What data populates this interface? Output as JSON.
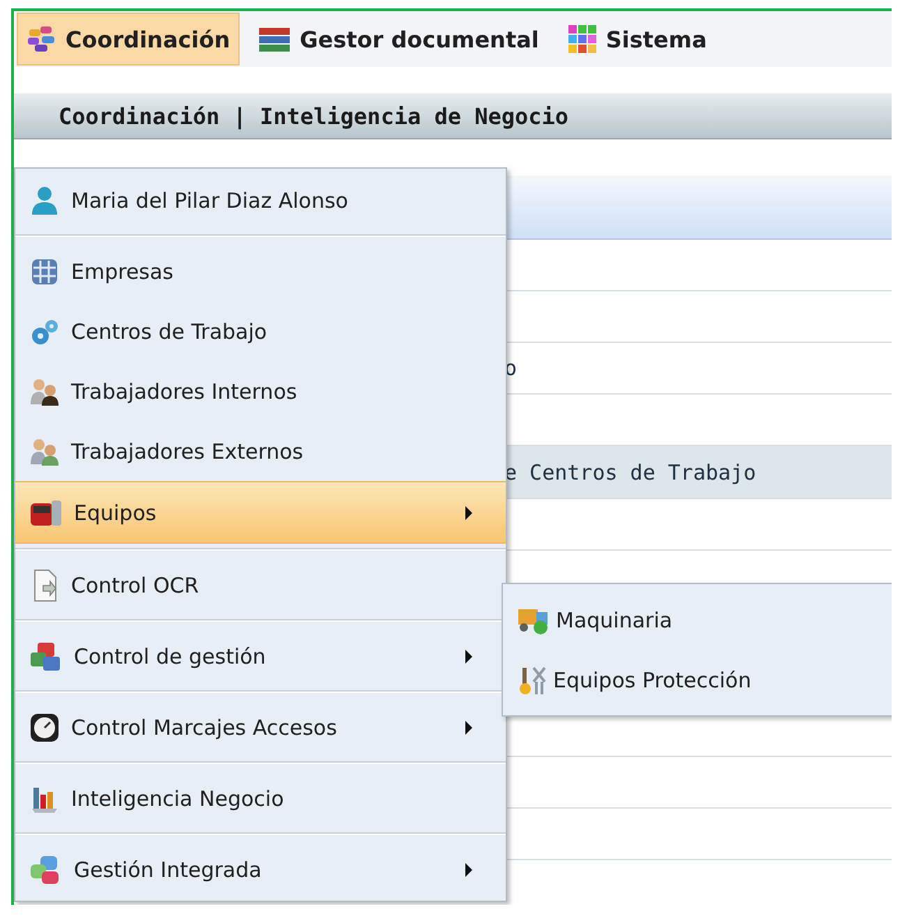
{
  "menubar": [
    {
      "label": "Coordinación",
      "selected": true
    },
    {
      "label": "Gestor documental",
      "selected": false
    },
    {
      "label": "Sistema",
      "selected": false
    }
  ],
  "breadcrumb": "Coordinación | Inteligencia de Negocio",
  "background_rows": [
    {
      "kind": "blank"
    },
    {
      "kind": "header"
    },
    {
      "kind": "row"
    },
    {
      "kind": "row"
    },
    {
      "kind": "row",
      "text": "o"
    },
    {
      "kind": "row"
    },
    {
      "kind": "section",
      "text": "e Centros de Trabajo"
    },
    {
      "kind": "row"
    },
    {
      "kind": "row"
    },
    {
      "kind": "row"
    },
    {
      "kind": "row"
    },
    {
      "kind": "row"
    },
    {
      "kind": "row"
    },
    {
      "kind": "row"
    }
  ],
  "menu": [
    {
      "label": "Maria del Pilar Diaz Alonso",
      "submenu": false,
      "selected": false,
      "divider_after": true
    },
    {
      "label": "Empresas",
      "submenu": false,
      "selected": false,
      "divider_after": false
    },
    {
      "label": "Centros de Trabajo",
      "submenu": false,
      "selected": false,
      "divider_after": false
    },
    {
      "label": "Trabajadores Internos",
      "submenu": false,
      "selected": false,
      "divider_after": false
    },
    {
      "label": "Trabajadores Externos",
      "submenu": false,
      "selected": false,
      "divider_after": false
    },
    {
      "label": "Equipos",
      "submenu": true,
      "selected": true,
      "divider_after": true
    },
    {
      "label": "Control OCR",
      "submenu": false,
      "selected": false,
      "divider_after": true
    },
    {
      "label": "Control de gestión",
      "submenu": true,
      "selected": false,
      "divider_after": true
    },
    {
      "label": "Control Marcajes Accesos",
      "submenu": true,
      "selected": false,
      "divider_after": true
    },
    {
      "label": "Inteligencia Negocio",
      "submenu": false,
      "selected": false,
      "divider_after": true
    },
    {
      "label": "Gestión Integrada",
      "submenu": true,
      "selected": false,
      "divider_after": false
    }
  ],
  "submenu": [
    {
      "label": "Maquinaria"
    },
    {
      "label": "Equipos Protección"
    }
  ]
}
